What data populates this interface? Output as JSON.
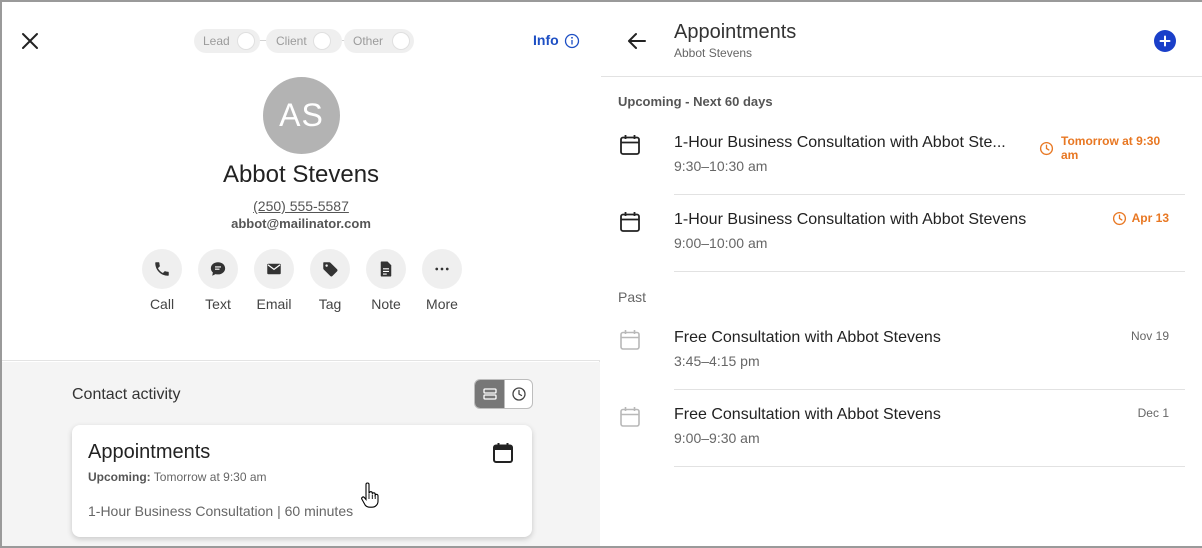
{
  "left": {
    "stages": [
      {
        "label": "Lead"
      },
      {
        "label": "Client"
      },
      {
        "label": "Other"
      }
    ],
    "info_label": "Info",
    "contact": {
      "initials": "AS",
      "name": "Abbot Stevens",
      "phone": "(250) 555-5587",
      "email": "abbot@mailinator.com"
    },
    "actions": [
      {
        "label": "Call",
        "icon": "phone-icon"
      },
      {
        "label": "Text",
        "icon": "chat-icon"
      },
      {
        "label": "Email",
        "icon": "mail-icon"
      },
      {
        "label": "Tag",
        "icon": "tag-icon"
      },
      {
        "label": "Note",
        "icon": "note-icon"
      },
      {
        "label": "More",
        "icon": "more-icon"
      }
    ],
    "activity": {
      "title": "Contact activity",
      "card": {
        "title": "Appointments",
        "upcoming_label": "Upcoming:",
        "upcoming_value": "Tomorrow at 9:30 am",
        "detail": "1-Hour Business Consultation | 60 minutes"
      }
    }
  },
  "right": {
    "title": "Appointments",
    "subtitle": "Abbot Stevens",
    "upcoming_label": "Upcoming - Next 60 days",
    "past_label": "Past",
    "upcoming": [
      {
        "title": "1-Hour Business Consultation with Abbot Ste...",
        "time": "9:30–10:30 am",
        "date_line1": "Tomorrow at 9:30",
        "date_line2": "am"
      },
      {
        "title": "1-Hour Business Consultation with Abbot Stevens",
        "time": "9:00–10:00 am",
        "date_line1": "Apr 13",
        "date_line2": ""
      }
    ],
    "past": [
      {
        "title": "Free Consultation with Abbot Stevens",
        "time": "3:45–4:15 pm",
        "date_line1": "Nov 19"
      },
      {
        "title": "Free Consultation with Abbot Stevens",
        "time": "9:00–9:30 am",
        "date_line1": "Dec 1"
      }
    ]
  },
  "colors": {
    "accent": "#1a3fc9",
    "link": "#1d4fc4",
    "soon": "#e87722"
  }
}
